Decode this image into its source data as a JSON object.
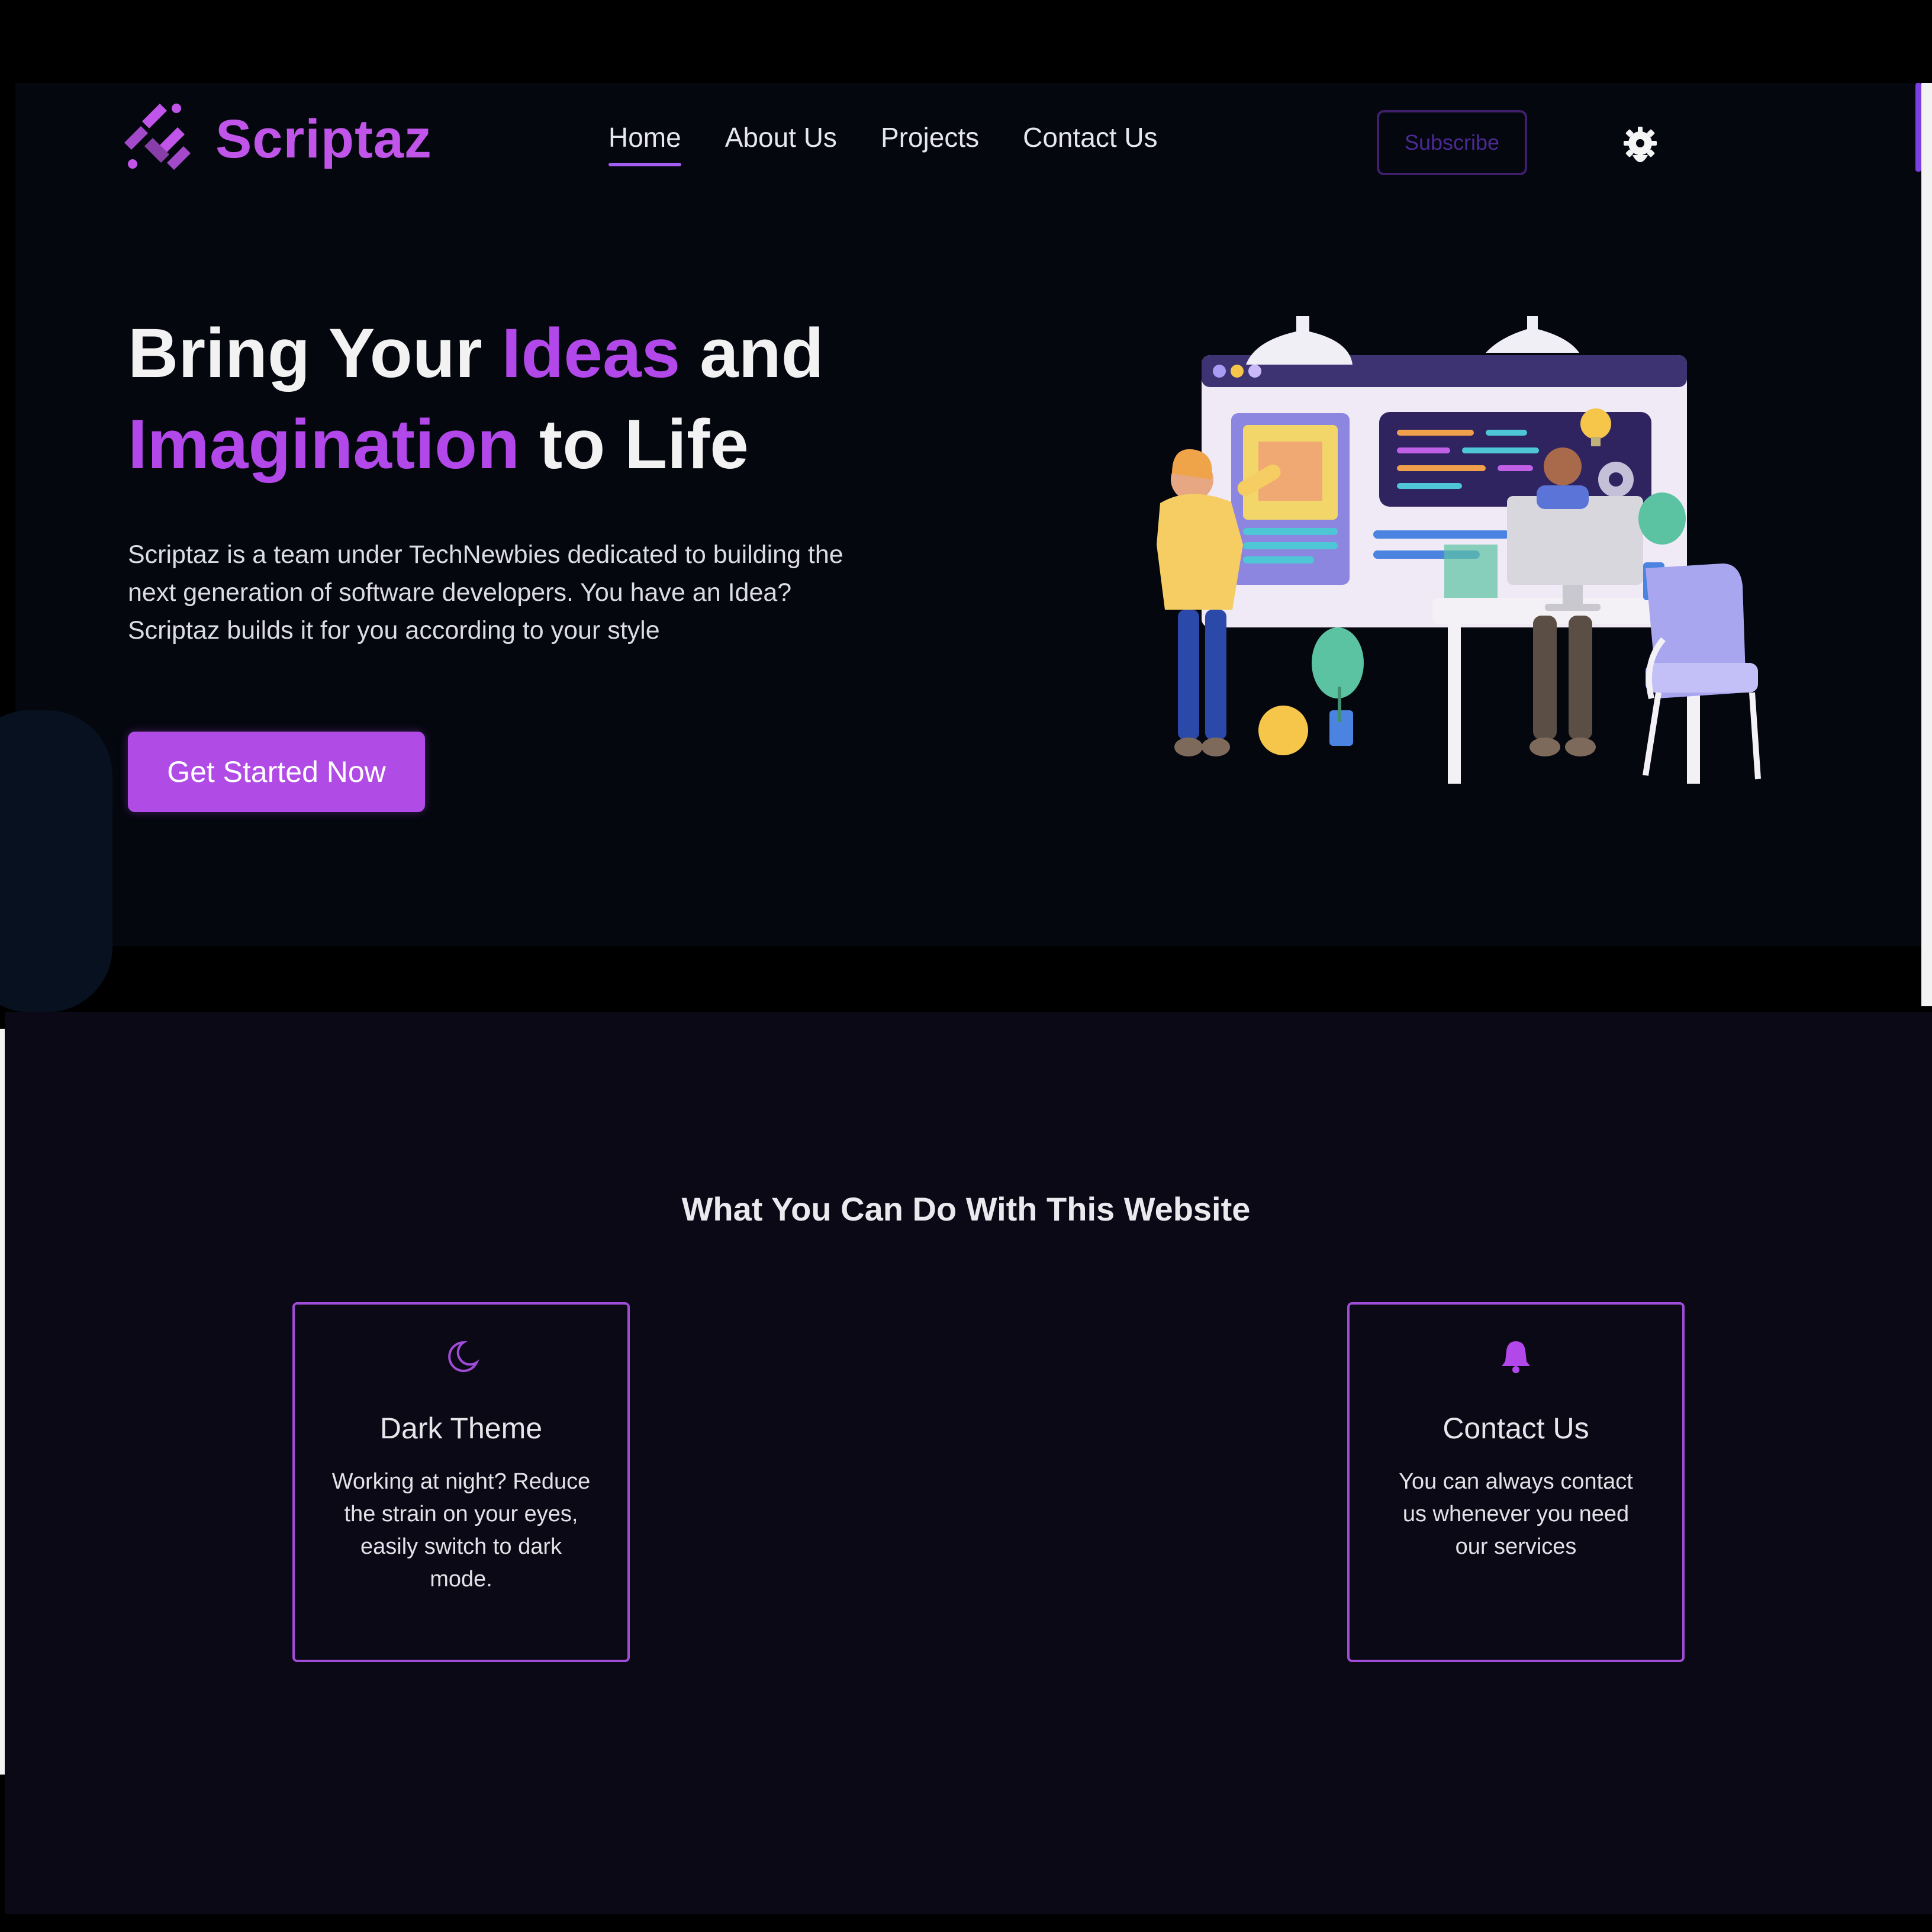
{
  "brand": {
    "name": "Scriptaz",
    "accent": "#b248ea",
    "logo_icon": "code-brackets-logo-icon"
  },
  "nav": {
    "items": [
      {
        "label": "Home",
        "active": true
      },
      {
        "label": "About Us",
        "active": false
      },
      {
        "label": "Projects",
        "active": false
      },
      {
        "label": "Contact Us",
        "active": false
      }
    ]
  },
  "header": {
    "subscribe_label": "Subscribe",
    "theme_toggle_icon": "gear-icon"
  },
  "hero": {
    "title_line1_a": "Bring Your ",
    "title_line1_hl": "Ideas",
    "title_line1_b": " and",
    "title_line2_hl": "Imagination",
    "title_line2_b": " to Life",
    "description": "Scriptaz is a team under TechNewbies dedicated to building the next generation of software developers. You have an Idea? Scriptaz builds it for you according to your style",
    "cta_label": "Get Started Now"
  },
  "features": {
    "heading": "What You Can Do With This Website",
    "cards": [
      {
        "icon": "moon-icon",
        "title": "Dark Theme",
        "text": "Working at night? Reduce the strain on your eyes, easily switch to dark mode."
      },
      {
        "icon": "bell-icon",
        "title": "Contact Us",
        "text": "You can always contact us whenever you need our services"
      }
    ]
  },
  "colors": {
    "page_bg": "#05070f",
    "section_bg": "#0b0916",
    "card_border": "#a04cd8"
  }
}
